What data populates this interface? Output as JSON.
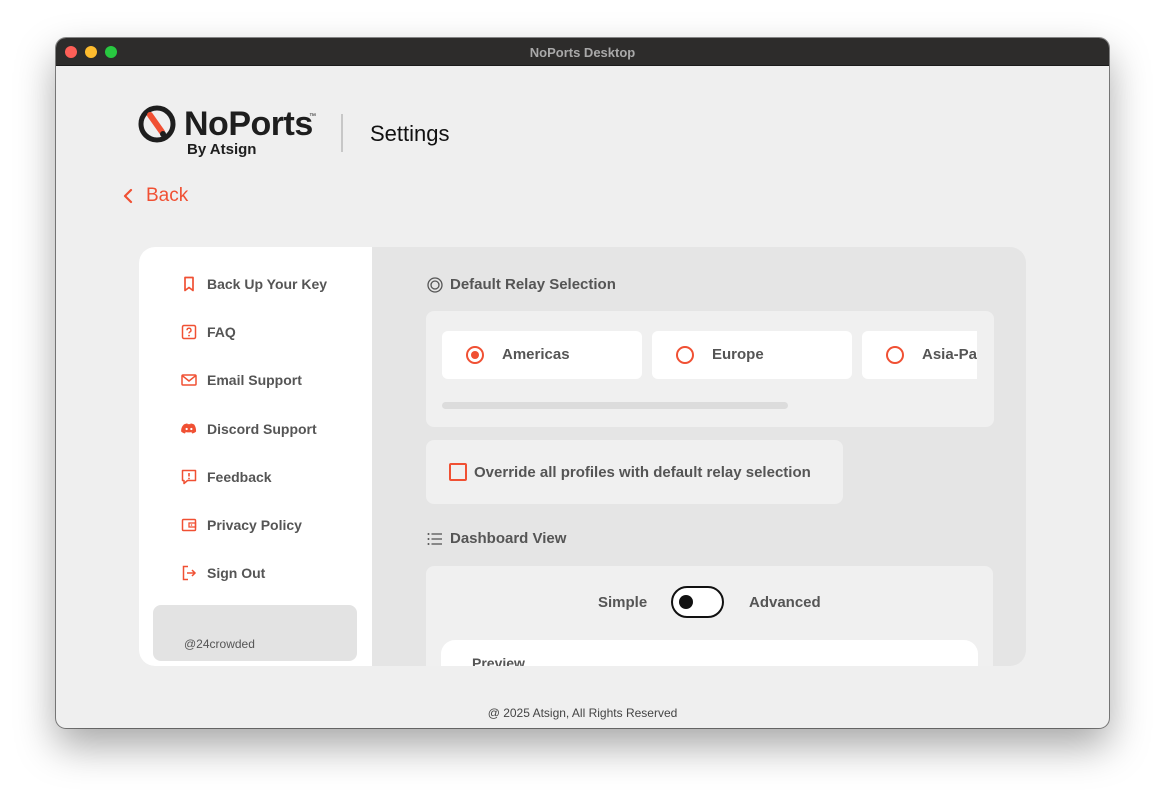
{
  "window": {
    "title": "NoPorts Desktop"
  },
  "brand": {
    "name": "NoPorts",
    "trademark": "™",
    "tagline": "By Atsign",
    "accent_color": "#f05033"
  },
  "header": {
    "title": "Settings"
  },
  "nav": {
    "back_label": "Back"
  },
  "sidebar": {
    "items": [
      {
        "label": "Back Up Your Key",
        "icon": "bookmark-icon"
      },
      {
        "label": "FAQ",
        "icon": "help-square-icon"
      },
      {
        "label": "Email Support",
        "icon": "mail-icon"
      },
      {
        "label": "Discord Support",
        "icon": "discord-icon"
      },
      {
        "label": "Feedback",
        "icon": "feedback-icon"
      },
      {
        "label": "Privacy Policy",
        "icon": "wallet-icon"
      },
      {
        "label": "Sign Out",
        "icon": "sign-out-icon"
      }
    ],
    "user": "@24crowded"
  },
  "relay": {
    "heading": "Default Relay Selection",
    "options": [
      {
        "label": "Americas",
        "selected": true
      },
      {
        "label": "Europe",
        "selected": false
      },
      {
        "label": "Asia-Pacific",
        "selected": false
      }
    ],
    "override_label": "Override all profiles with default relay selection",
    "override_checked": false
  },
  "dashboard": {
    "heading": "Dashboard View",
    "simple_label": "Simple",
    "advanced_label": "Advanced",
    "mode": "Simple",
    "preview_label": "Preview"
  },
  "footer": {
    "copyright": "@ 2025 Atsign, All Rights Reserved"
  }
}
